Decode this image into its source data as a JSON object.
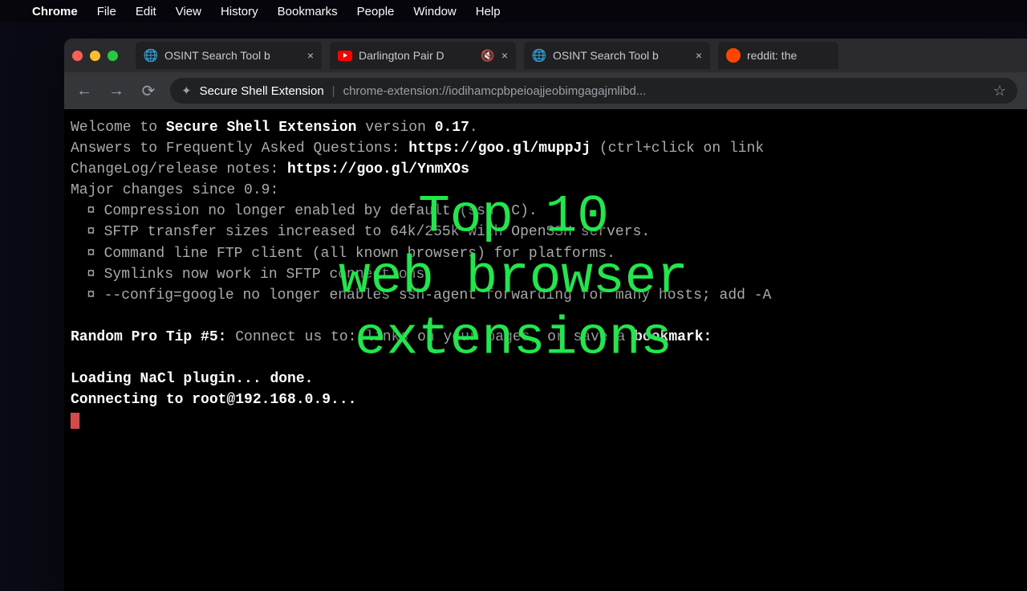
{
  "menubar": {
    "app_name": "Chrome",
    "items": [
      "File",
      "Edit",
      "View",
      "History",
      "Bookmarks",
      "People",
      "Window",
      "Help"
    ]
  },
  "tabs": [
    {
      "title": "OSINT Search Tool b",
      "icon": "globe"
    },
    {
      "title": "Darlington Pair D",
      "icon": "youtube",
      "muted": true
    },
    {
      "title": "OSINT Search Tool b",
      "icon": "globe"
    },
    {
      "title": "reddit: the",
      "icon": "reddit"
    }
  ],
  "addressbar": {
    "extension_label": "Secure Shell Extension",
    "url": "chrome-extension://iodihamcpbpeioajjeobimgagajmlibd..."
  },
  "terminal": {
    "welcome_prefix": "Welcome to ",
    "welcome_name": "Secure Shell Extension",
    "welcome_version": " version ",
    "version": "0.17",
    "faq_prefix": "Answers to Frequently Asked Questions: ",
    "faq_url": "https://goo.gl/muppJj",
    "faq_hint": " (ctrl+click on link",
    "changelog_label": "ChangeLog/release notes: ",
    "changelog_url": "https://goo.gl/YnmXOs",
    "changes_label": "Major changes since 0.9:",
    "changes": [
      "Compression no longer enabled by default (ssh -C).",
      "SFTP transfer sizes increased to 64k/255k with OpenSSH servers.",
      "Command line FTP client (all known browsers) for platforms.",
      "Symlinks now work in SFTP connections.",
      "--config=google no longer enables ssh-agent forwarding for many hosts; add -A"
    ],
    "protip_prefix": "Random Pro Tip #5:",
    "protip_text": " Connect us to: links on your pages, or save a ",
    "protip_bold": "bookmark:",
    "loading": "Loading NaCl plugin... done.",
    "connecting": "Connecting to root@192.168.0.9..."
  },
  "overlay": {
    "line1": "Top 10",
    "line2": "web browser",
    "line3": "extensions"
  }
}
